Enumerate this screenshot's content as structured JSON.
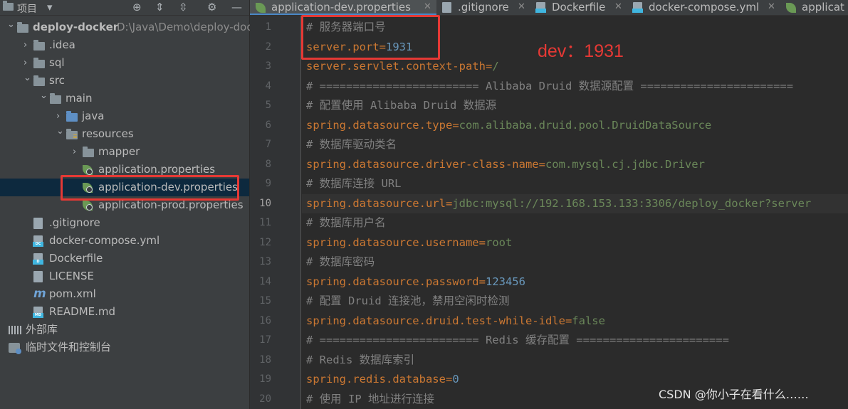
{
  "project_panel": {
    "title": "项目",
    "tree": [
      {
        "label": "deploy-docker",
        "hint": "D:\\Java\\Demo\\deploy-dock",
        "icon": "folder",
        "indent": 0,
        "expanded": true
      },
      {
        "label": ".idea",
        "icon": "folder",
        "indent": 1,
        "expanded": false
      },
      {
        "label": "sql",
        "icon": "folder",
        "indent": 1,
        "expanded": false
      },
      {
        "label": "src",
        "icon": "folder",
        "indent": 1,
        "expanded": true
      },
      {
        "label": "main",
        "icon": "folder",
        "indent": 2,
        "expanded": true
      },
      {
        "label": "java",
        "icon": "folder-blue",
        "indent": 3,
        "expanded": false
      },
      {
        "label": "resources",
        "icon": "folder-resources",
        "indent": 3,
        "expanded": true
      },
      {
        "label": "mapper",
        "icon": "folder",
        "indent": 4,
        "expanded": false
      },
      {
        "label": "application.properties",
        "icon": "spring-leaf",
        "indent": 4
      },
      {
        "label": "application-dev.properties",
        "icon": "spring-leaf",
        "indent": 4,
        "selected": true
      },
      {
        "label": "application-prod.properties",
        "icon": "spring-leaf",
        "indent": 4
      },
      {
        "label": ".gitignore",
        "icon": "file",
        "indent": 1
      },
      {
        "label": "docker-compose.yml",
        "icon": "file-dc",
        "indent": 1
      },
      {
        "label": "Dockerfile",
        "icon": "file-d",
        "indent": 1
      },
      {
        "label": "LICENSE",
        "icon": "file",
        "indent": 1
      },
      {
        "label": "pom.xml",
        "icon": "maven-m",
        "indent": 1
      },
      {
        "label": "README.md",
        "icon": "file-md",
        "indent": 1
      },
      {
        "label": "外部库",
        "icon": "library",
        "indent": 0
      },
      {
        "label": "临时文件和控制台",
        "icon": "scratch",
        "indent": 0
      }
    ]
  },
  "tabs": [
    {
      "label": "application-dev.properties",
      "icon": "spring-leaf",
      "active": true
    },
    {
      "label": ".gitignore",
      "icon": "file"
    },
    {
      "label": "Dockerfile",
      "icon": "file-d"
    },
    {
      "label": "docker-compose.yml",
      "icon": "file-dc"
    },
    {
      "label": "applicat",
      "icon": "spring-leaf"
    }
  ],
  "editor": {
    "current_line": 10,
    "lines": [
      {
        "n": "1",
        "parts": [
          {
            "t": "# 服务器端口号",
            "c": "cmt"
          }
        ]
      },
      {
        "n": "2",
        "parts": [
          {
            "t": "server.port",
            "c": "key"
          },
          {
            "t": "=",
            "c": "eq"
          },
          {
            "t": "1931",
            "c": "num"
          }
        ]
      },
      {
        "n": "3",
        "parts": [
          {
            "t": "server.servlet.context-path",
            "c": "key"
          },
          {
            "t": "=",
            "c": "eq"
          },
          {
            "t": "/",
            "c": "val"
          }
        ]
      },
      {
        "n": "4",
        "parts": [
          {
            "t": "# ======================== Alibaba Druid 数据源配置 =======================",
            "c": "cmt"
          }
        ]
      },
      {
        "n": "5",
        "parts": [
          {
            "t": "# 配置使用 Alibaba Druid 数据源",
            "c": "cmt"
          }
        ]
      },
      {
        "n": "6",
        "parts": [
          {
            "t": "spring.datasource.type",
            "c": "key"
          },
          {
            "t": "=",
            "c": "eq"
          },
          {
            "t": "com.alibaba.druid.pool.DruidDataSource",
            "c": "val"
          }
        ]
      },
      {
        "n": "7",
        "parts": [
          {
            "t": "# 数据库驱动类名",
            "c": "cmt"
          }
        ]
      },
      {
        "n": "8",
        "parts": [
          {
            "t": "spring.datasource.driver-class-name",
            "c": "key"
          },
          {
            "t": "=",
            "c": "eq"
          },
          {
            "t": "com.mysql.cj.jdbc.Driver",
            "c": "val"
          }
        ]
      },
      {
        "n": "9",
        "parts": [
          {
            "t": "# 数据库连接 URL",
            "c": "cmt"
          }
        ]
      },
      {
        "n": "10",
        "parts": [
          {
            "t": "spring.datasource.url",
            "c": "key"
          },
          {
            "t": "=",
            "c": "eq"
          },
          {
            "t": "jdbc:mysql://192.168.153.133:3306/deploy_docker?server",
            "c": "val"
          }
        ]
      },
      {
        "n": "11",
        "parts": [
          {
            "t": "# 数据库用户名",
            "c": "cmt"
          }
        ]
      },
      {
        "n": "12",
        "parts": [
          {
            "t": "spring.datasource.username",
            "c": "key"
          },
          {
            "t": "=",
            "c": "eq"
          },
          {
            "t": "root",
            "c": "val"
          }
        ]
      },
      {
        "n": "13",
        "parts": [
          {
            "t": "# 数据库密码",
            "c": "cmt"
          }
        ]
      },
      {
        "n": "14",
        "parts": [
          {
            "t": "spring.datasource.password",
            "c": "key"
          },
          {
            "t": "=",
            "c": "eq"
          },
          {
            "t": "123456",
            "c": "num"
          }
        ]
      },
      {
        "n": "15",
        "parts": [
          {
            "t": "# 配置 Druid 连接池，禁用空闲时检测",
            "c": "cmt"
          }
        ]
      },
      {
        "n": "16",
        "parts": [
          {
            "t": "spring.datasource.druid.test-while-idle",
            "c": "key"
          },
          {
            "t": "=",
            "c": "eq"
          },
          {
            "t": "false",
            "c": "val"
          }
        ]
      },
      {
        "n": "17",
        "parts": [
          {
            "t": "# ======================== Redis 缓存配置 =======================",
            "c": "cmt"
          }
        ]
      },
      {
        "n": "18",
        "parts": [
          {
            "t": "# Redis 数据库索引",
            "c": "cmt"
          }
        ]
      },
      {
        "n": "19",
        "parts": [
          {
            "t": "spring.redis.database",
            "c": "key"
          },
          {
            "t": "=",
            "c": "eq"
          },
          {
            "t": "0",
            "c": "num"
          }
        ]
      },
      {
        "n": "20",
        "parts": [
          {
            "t": "# 使用 IP 地址进行连接",
            "c": "cmt"
          }
        ]
      }
    ]
  },
  "annotation": "dev：1931",
  "watermark": "CSDN @你小子在看什么……",
  "colors": {
    "annotation_red": "#e53935",
    "key_orange": "#cc7832",
    "value_green": "#6a8759",
    "number_blue": "#6897bb",
    "comment_gray": "#808080"
  }
}
